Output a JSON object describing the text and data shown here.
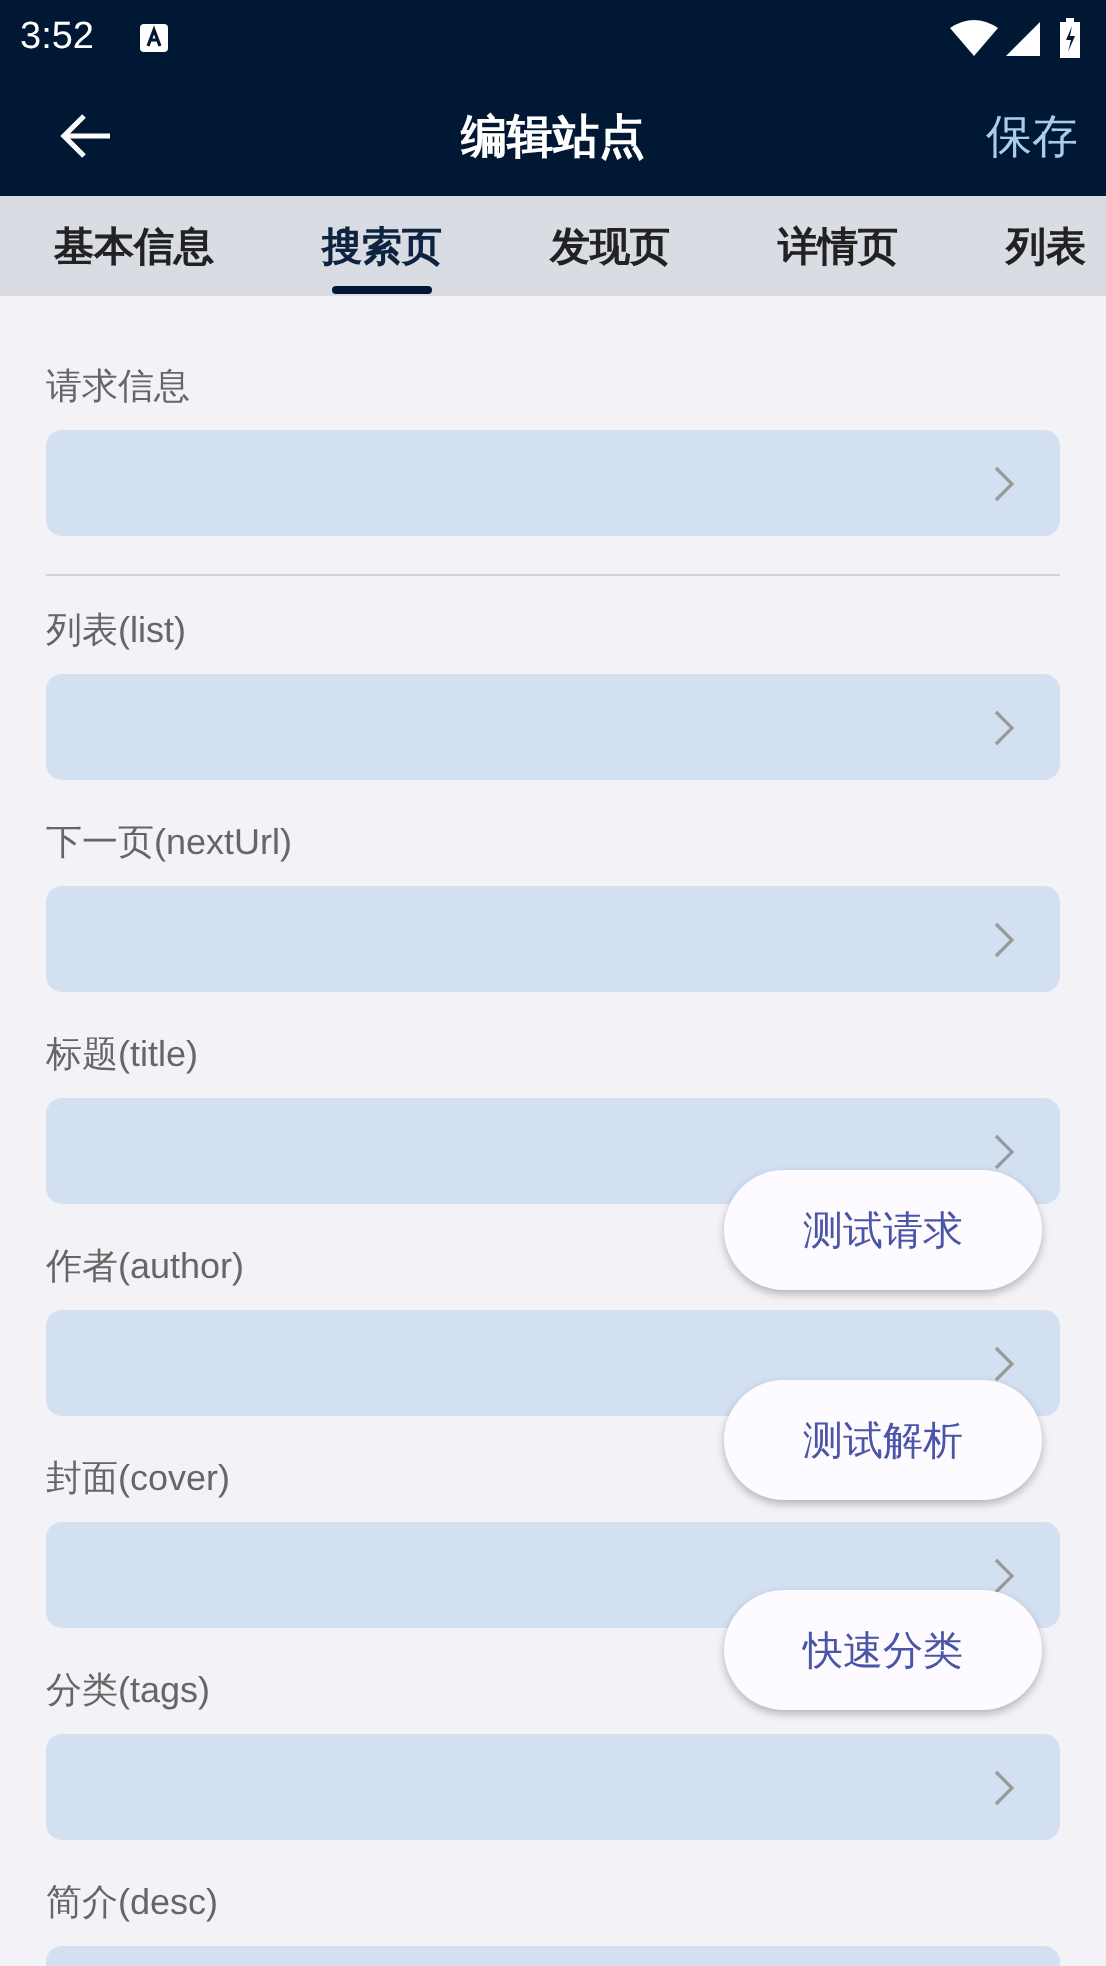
{
  "status_bar": {
    "time": "3:52"
  },
  "app_bar": {
    "title": "编辑站点",
    "action": "保存"
  },
  "tabs": [
    {
      "label": "基本信息",
      "selected": false
    },
    {
      "label": "搜索页",
      "selected": true
    },
    {
      "label": "发现页",
      "selected": false
    },
    {
      "label": "详情页",
      "selected": false
    },
    {
      "label": "列表",
      "selected": false
    }
  ],
  "sections": [
    {
      "fields": [
        {
          "label": "请求信息"
        }
      ]
    },
    {
      "fields": [
        {
          "label": "列表(list)"
        },
        {
          "label": "下一页(nextUrl)"
        },
        {
          "label": "标题(title)"
        },
        {
          "label": "作者(author)"
        },
        {
          "label": "封面(cover)"
        },
        {
          "label": "分类(tags)"
        },
        {
          "label": "简介(desc)"
        }
      ]
    }
  ],
  "actions": [
    "测试请求",
    "测试解析",
    "快速分类"
  ]
}
